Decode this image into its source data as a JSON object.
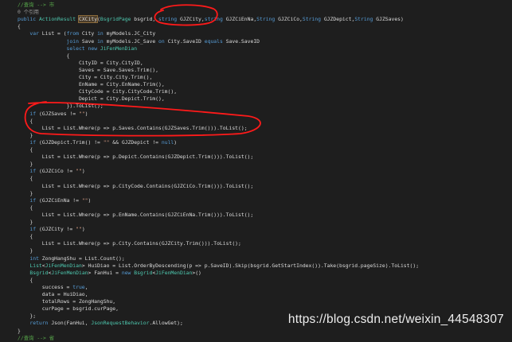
{
  "editor": {
    "lines": [
      [
        {
          "t": "//查询 --> 市",
          "k": "cmt"
        }
      ],
      [
        {
          "t": "0 个引用",
          "k": "ref"
        }
      ],
      [
        {
          "t": "public ",
          "k": "kw"
        },
        {
          "t": "ActionResult ",
          "k": "type"
        },
        {
          "t": "CXCity",
          "k": "hl"
        },
        {
          "t": "(",
          "k": "id"
        },
        {
          "t": "BsgridPage ",
          "k": "type"
        },
        {
          "t": "bsgrid, ",
          "k": "id"
        },
        {
          "t": "string ",
          "k": "kw"
        },
        {
          "t": "GJZCity,",
          "k": "id"
        },
        {
          "t": "string ",
          "k": "kw"
        },
        {
          "t": "GJZCiEnNa,",
          "k": "id"
        },
        {
          "t": "String ",
          "k": "kw"
        },
        {
          "t": "GJZCiCo,",
          "k": "id"
        },
        {
          "t": "String ",
          "k": "kw"
        },
        {
          "t": "GJZDepict,",
          "k": "id"
        },
        {
          "t": "String ",
          "k": "kw"
        },
        {
          "t": "GJZSaves)",
          "k": "id"
        }
      ],
      [
        {
          "t": "{",
          "k": "id"
        }
      ],
      [
        {
          "t": "    var ",
          "k": "kw"
        },
        {
          "t": "List = (",
          "k": "id"
        },
        {
          "t": "from ",
          "k": "kw"
        },
        {
          "t": "City ",
          "k": "id"
        },
        {
          "t": "in ",
          "k": "kw"
        },
        {
          "t": "myModels.JC_City",
          "k": "id"
        }
      ],
      [
        {
          "t": "                join ",
          "k": "kw"
        },
        {
          "t": "Save ",
          "k": "id"
        },
        {
          "t": "in ",
          "k": "kw"
        },
        {
          "t": "myModels.JC_Save ",
          "k": "id"
        },
        {
          "t": "on ",
          "k": "kw"
        },
        {
          "t": "City.SaveID ",
          "k": "id"
        },
        {
          "t": "equals ",
          "k": "kw"
        },
        {
          "t": "Save.SaveID",
          "k": "id"
        }
      ],
      [
        {
          "t": "                select ",
          "k": "kw"
        },
        {
          "t": "new ",
          "k": "kw"
        },
        {
          "t": "JiFenMenDian",
          "k": "type"
        }
      ],
      [
        {
          "t": "                {",
          "k": "id"
        }
      ],
      [
        {
          "t": "                    CityID = City.CityID,",
          "k": "id"
        }
      ],
      [
        {
          "t": "                    Saves = Save.Saves.Trim(),",
          "k": "id"
        }
      ],
      [
        {
          "t": "                    City = City.City.Trim(),",
          "k": "id"
        }
      ],
      [
        {
          "t": "                    EnName = City.EnName.Trim(),",
          "k": "id"
        }
      ],
      [
        {
          "t": "                    CityCode = City.CityCode.Trim(),",
          "k": "id"
        }
      ],
      [
        {
          "t": "                    Depict = City.Depict.Trim(),",
          "k": "id"
        }
      ],
      [
        {
          "t": "                }).ToList();",
          "k": "id"
        }
      ],
      [
        {
          "t": "    if ",
          "k": "kw"
        },
        {
          "t": "(GJZSaves != ",
          "k": "id"
        },
        {
          "t": "\"\"",
          "k": "str"
        },
        {
          "t": ")",
          "k": "id"
        }
      ],
      [
        {
          "t": "    {",
          "k": "id"
        }
      ],
      [
        {
          "t": "        List = List.Where(p => p.Saves.Contains(GJZSaves.Trim())).ToList();",
          "k": "id"
        }
      ],
      [
        {
          "t": "    }",
          "k": "id"
        }
      ],
      [
        {
          "t": "    if ",
          "k": "kw"
        },
        {
          "t": "(GJZDepict.Trim() != ",
          "k": "id"
        },
        {
          "t": "\"\"",
          "k": "str"
        },
        {
          "t": " && GJZDepict != ",
          "k": "id"
        },
        {
          "t": "null",
          "k": "kw"
        },
        {
          "t": ")",
          "k": "id"
        }
      ],
      [
        {
          "t": "    {",
          "k": "id"
        }
      ],
      [
        {
          "t": "        List = List.Where(p => p.Depict.Contains(GJZDepict.Trim())).ToList();",
          "k": "id"
        }
      ],
      [
        {
          "t": "    }",
          "k": "id"
        }
      ],
      [
        {
          "t": "    if ",
          "k": "kw"
        },
        {
          "t": "(GJZCiCo != ",
          "k": "id"
        },
        {
          "t": "\"\"",
          "k": "str"
        },
        {
          "t": ")",
          "k": "id"
        }
      ],
      [
        {
          "t": "    {",
          "k": "id"
        }
      ],
      [
        {
          "t": "        List = List.Where(p => p.CityCode.Contains(GJZCiCo.Trim())).ToList();",
          "k": "id"
        }
      ],
      [
        {
          "t": "    }",
          "k": "id"
        }
      ],
      [
        {
          "t": "    if ",
          "k": "kw"
        },
        {
          "t": "(GJZCiEnNa != ",
          "k": "id"
        },
        {
          "t": "\"\"",
          "k": "str"
        },
        {
          "t": ")",
          "k": "id"
        }
      ],
      [
        {
          "t": "    {",
          "k": "id"
        }
      ],
      [
        {
          "t": "        List = List.Where(p => p.EnName.Contains(GJZCiEnNa.Trim())).ToList();",
          "k": "id"
        }
      ],
      [
        {
          "t": "    }",
          "k": "id"
        }
      ],
      [
        {
          "t": "    if ",
          "k": "kw"
        },
        {
          "t": "(GJZCity != ",
          "k": "id"
        },
        {
          "t": "\"\"",
          "k": "str"
        },
        {
          "t": ")",
          "k": "id"
        }
      ],
      [
        {
          "t": "    {",
          "k": "id"
        }
      ],
      [
        {
          "t": "        List = List.Where(p => p.City.Contains(GJZCity.Trim())).ToList();",
          "k": "id"
        }
      ],
      [
        {
          "t": "    }",
          "k": "id"
        }
      ],
      [
        {
          "t": "    int ",
          "k": "kw"
        },
        {
          "t": "ZongHangShu = List.Count();",
          "k": "id"
        }
      ],
      [
        {
          "t": "    List",
          "k": "type"
        },
        {
          "t": "<",
          "k": "id"
        },
        {
          "t": "JiFenMenDian",
          "k": "type"
        },
        {
          "t": "> HuiDiao = List.OrderByDescending(p => p.SaveID).Skip(bsgrid.GetStartIndex()).Take(bsgrid.pageSize).ToList();",
          "k": "id"
        }
      ],
      [
        {
          "t": "    Bsgrid",
          "k": "type"
        },
        {
          "t": "<",
          "k": "id"
        },
        {
          "t": "JiFenMenDian",
          "k": "type"
        },
        {
          "t": "> FanHui = ",
          "k": "id"
        },
        {
          "t": "new ",
          "k": "kw"
        },
        {
          "t": "Bsgrid",
          "k": "type"
        },
        {
          "t": "<",
          "k": "id"
        },
        {
          "t": "JiFenMenDian",
          "k": "type"
        },
        {
          "t": ">()",
          "k": "id"
        }
      ],
      [
        {
          "t": "    {",
          "k": "id"
        }
      ],
      [
        {
          "t": "        success = ",
          "k": "id"
        },
        {
          "t": "true",
          "k": "kw"
        },
        {
          "t": ",",
          "k": "id"
        }
      ],
      [
        {
          "t": "        data = HuiDiao,",
          "k": "id"
        }
      ],
      [
        {
          "t": "        totalRows = ZongHangShu,",
          "k": "id"
        }
      ],
      [
        {
          "t": "        curPage = bsgrid.curPage,",
          "k": "id"
        }
      ],
      [
        {
          "t": "    };",
          "k": "id"
        }
      ],
      [
        {
          "t": "    return ",
          "k": "kw"
        },
        {
          "t": "Json(FanHui, ",
          "k": "id"
        },
        {
          "t": "JsonRequestBehavior",
          "k": "type"
        },
        {
          "t": ".AllowGet);",
          "k": "id"
        }
      ],
      [
        {
          "t": "}",
          "k": "id"
        }
      ],
      [
        {
          "t": "//查询 --> 省",
          "k": "cmt"
        }
      ]
    ]
  },
  "annotation_color": "#ff1a1a",
  "watermark": "https://blog.csdn.net/weixin_44548307"
}
